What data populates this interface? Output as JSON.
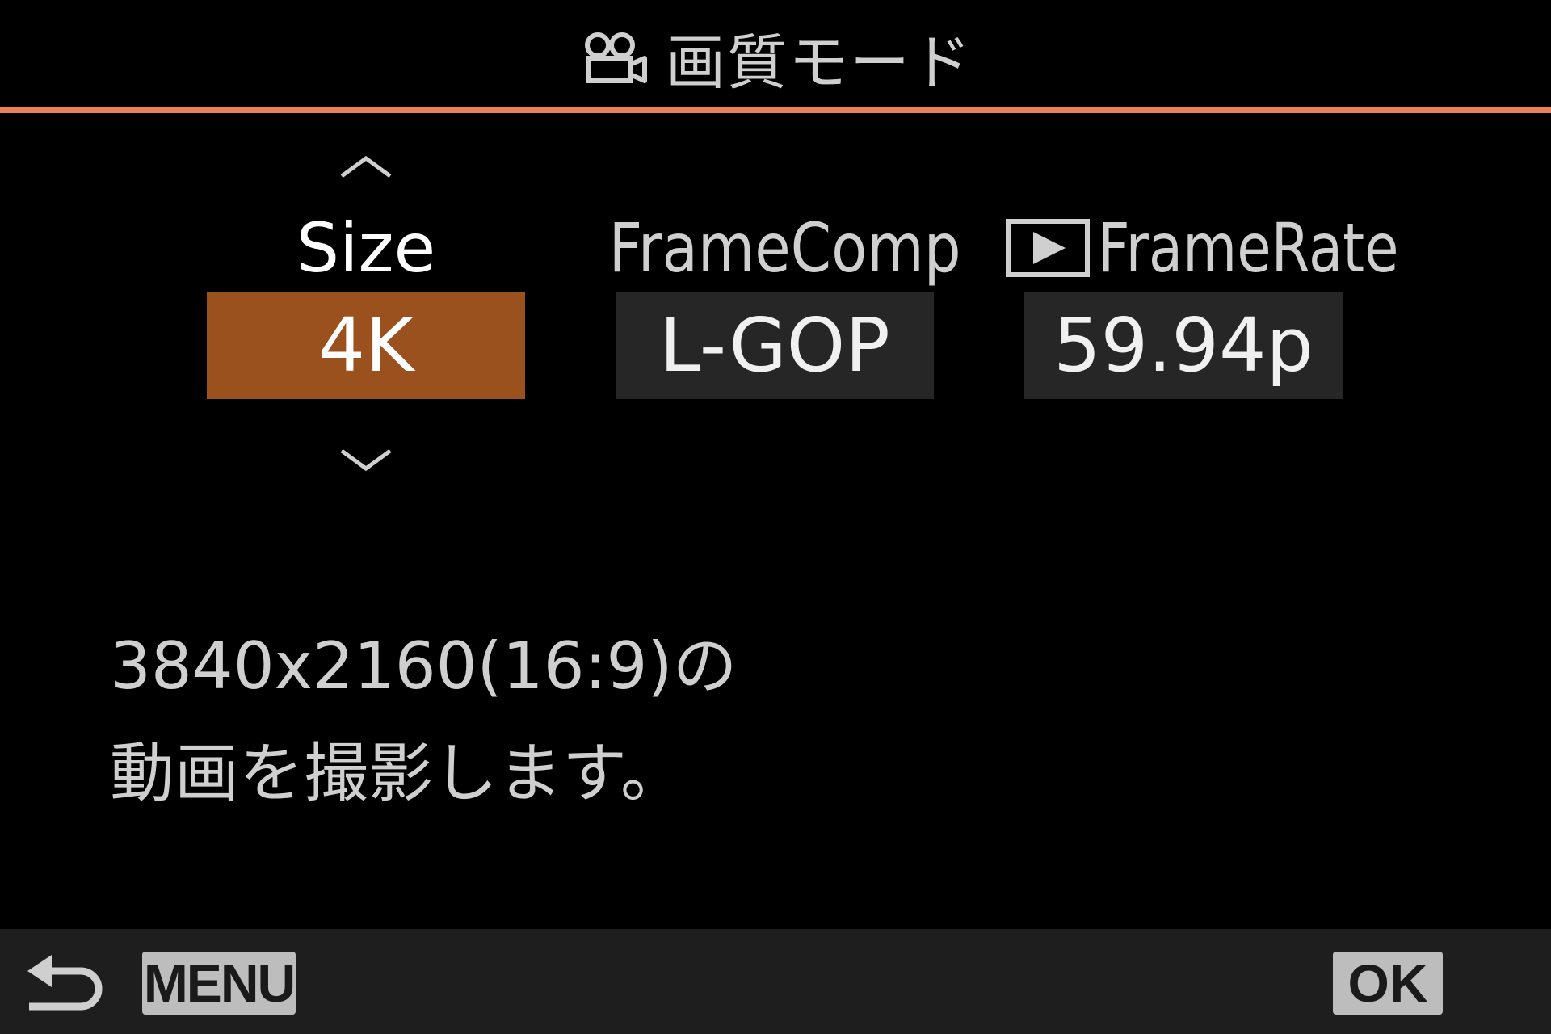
{
  "header": {
    "icon": "movie-camera-icon",
    "title": "画質モード"
  },
  "colors": {
    "accent": "#e8835b",
    "selected_value_bg": "#9a511d",
    "value_bg": "#262626",
    "footer_bg": "#1e1e1e",
    "button_bg": "#bdbdbd"
  },
  "settings": {
    "selected_column": "size",
    "size": {
      "label": "Size",
      "value": "4K"
    },
    "frame_comp": {
      "label": "FrameComp",
      "value": "L-GOP"
    },
    "frame_rate": {
      "icon": "playback-icon",
      "label": "FrameRate",
      "value": "59.94p"
    }
  },
  "description": {
    "line1": "3840x2160(16:9)の",
    "line2": "動画を撮影します。"
  },
  "footer": {
    "back_icon": "return-arrow-icon",
    "menu_label": "MENU",
    "ok_label": "OK"
  }
}
